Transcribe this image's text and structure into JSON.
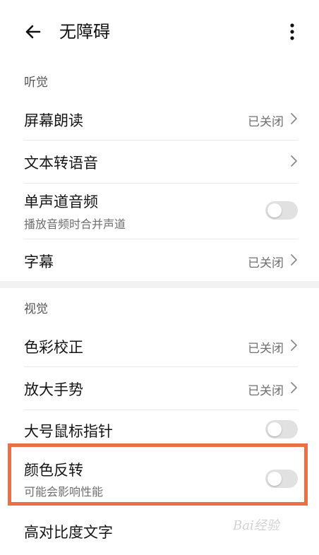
{
  "header": {
    "title": "无障碍",
    "back_icon": "arrow-left-icon",
    "more_icon": "more-vertical-icon"
  },
  "sections": {
    "hearing": "听觉",
    "vision": "视觉"
  },
  "items": {
    "screen_reader": {
      "label": "屏幕朗读",
      "value": "已关闭"
    },
    "tts": {
      "label": "文本转语音"
    },
    "mono_audio": {
      "label": "单声道音频",
      "sublabel": "播放音频时合并声道",
      "enabled": false
    },
    "captions": {
      "label": "字幕",
      "value": "已关闭"
    },
    "color_correction": {
      "label": "色彩校正",
      "value": "已关闭"
    },
    "magnify_gesture": {
      "label": "放大手势",
      "value": "已关闭"
    },
    "large_pointer": {
      "label": "大号鼠标指针",
      "enabled": false
    },
    "color_inversion": {
      "label": "颜色反转",
      "sublabel": "可能会影响性能",
      "enabled": false
    },
    "high_contrast": {
      "label": "高对比度文字"
    }
  },
  "watermark": "Bai经验",
  "colors": {
    "highlight": "#ec7046",
    "switch_off": "#e1e1e1"
  }
}
